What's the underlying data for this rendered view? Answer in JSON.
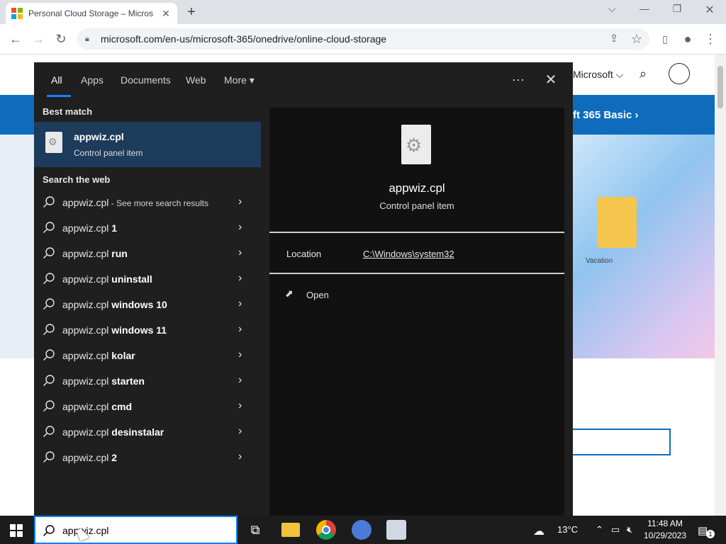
{
  "browser": {
    "tab_title": "Personal Cloud Storage – Micros",
    "tab_close": "✕",
    "new_tab": "+",
    "url": "microsoft.com/en-us/microsoft-365/onedrive/online-cloud-storage"
  },
  "page": {
    "header_microsoft": "Microsoft ⌵",
    "banner_text": "ft 365 Basic ›",
    "hero_label": "Vacation"
  },
  "search": {
    "tabs": [
      "All",
      "Apps",
      "Documents",
      "Web",
      "More ▾"
    ],
    "more_options": "···",
    "close": "✕",
    "best_match_heading": "Best match",
    "best_match": {
      "name": "appwiz.cpl",
      "type": "Control panel item"
    },
    "search_web_heading": "Search the web",
    "web_results": [
      {
        "prefix": "appwiz.cpl",
        "bold": "",
        "sub": " - See more search results"
      },
      {
        "prefix": "appwiz.cpl ",
        "bold": "1",
        "sub": ""
      },
      {
        "prefix": "appwiz.cpl ",
        "bold": "run",
        "sub": ""
      },
      {
        "prefix": "appwiz.cpl ",
        "bold": "uninstall",
        "sub": ""
      },
      {
        "prefix": "appwiz.cpl ",
        "bold": "windows 10",
        "sub": ""
      },
      {
        "prefix": "appwiz.cpl ",
        "bold": "windows 11",
        "sub": ""
      },
      {
        "prefix": "appwiz.cpl ",
        "bold": "kolar",
        "sub": ""
      },
      {
        "prefix": "appwiz.cpl ",
        "bold": "starten",
        "sub": ""
      },
      {
        "prefix": "appwiz.cpl ",
        "bold": "cmd",
        "sub": ""
      },
      {
        "prefix": "appwiz.cpl ",
        "bold": "desinstalar",
        "sub": ""
      },
      {
        "prefix": "appwiz.cpl ",
        "bold": "2",
        "sub": ""
      }
    ],
    "preview": {
      "name": "appwiz.cpl",
      "type": "Control panel item",
      "location_label": "Location",
      "location_value": "C:\\Windows\\system32",
      "open_label": "Open"
    }
  },
  "taskbar": {
    "search_value": "appwiz.cpl",
    "weather": "13°C",
    "time": "11:48 AM",
    "date": "10/29/2023",
    "notification_count": "1"
  }
}
